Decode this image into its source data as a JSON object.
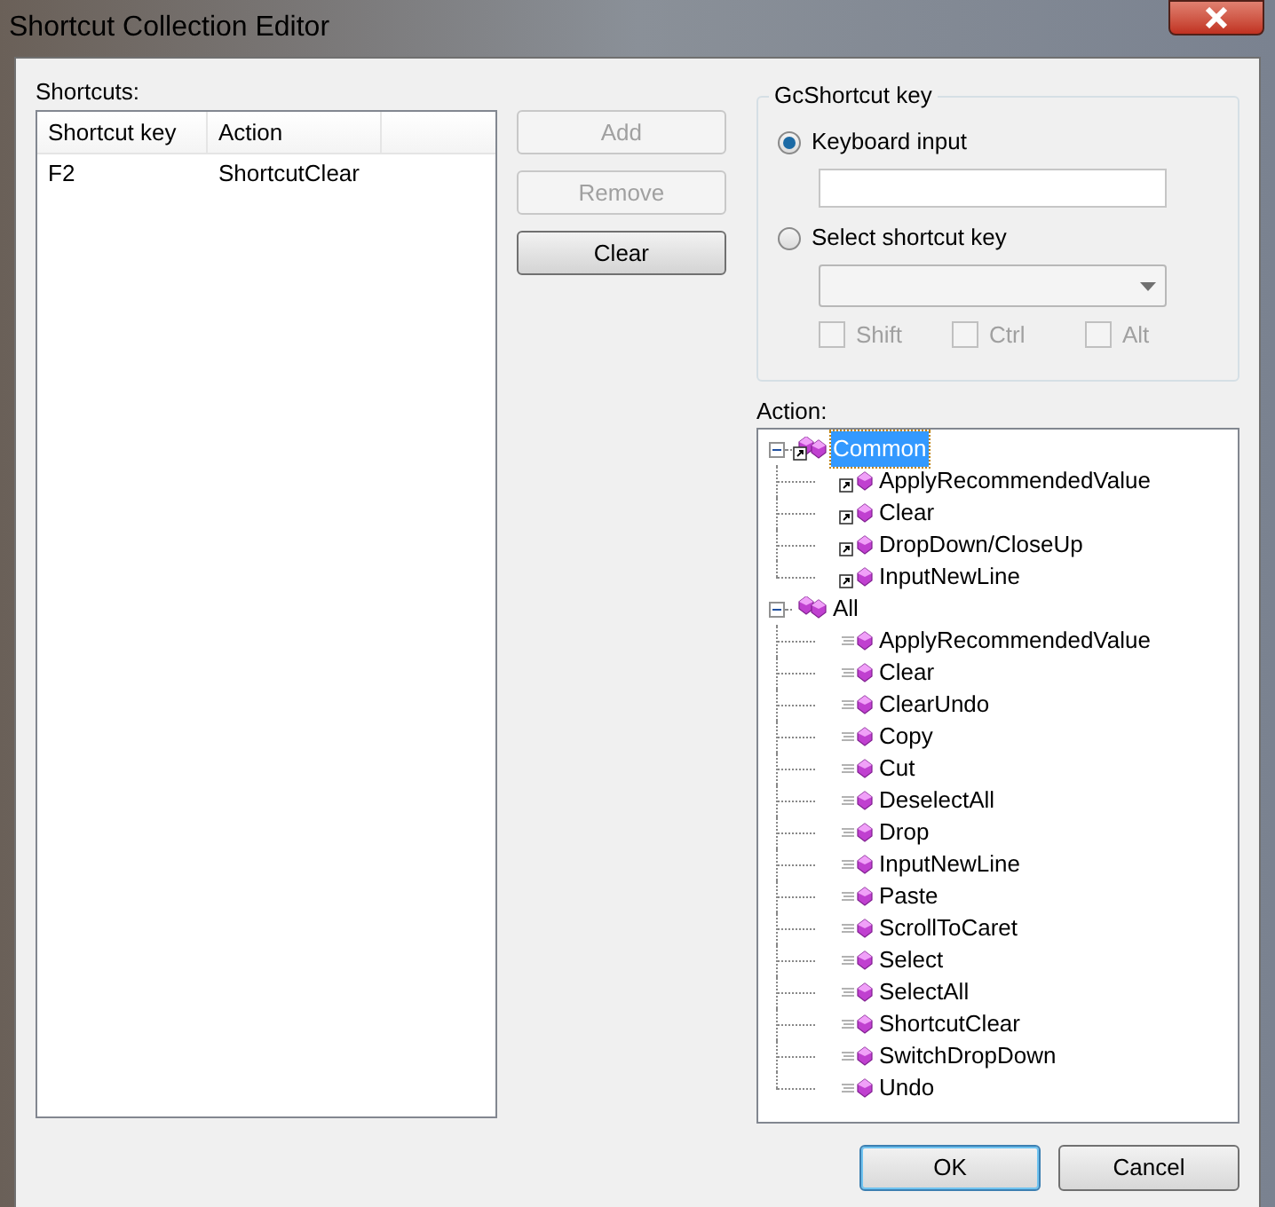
{
  "window": {
    "title": "Shortcut Collection Editor"
  },
  "shortcuts": {
    "label": "Shortcuts:",
    "columns": [
      "Shortcut key",
      "Action"
    ],
    "rows": [
      [
        "F2",
        "ShortcutClear"
      ]
    ]
  },
  "buttons": [
    {
      "label": "Add",
      "disabled": true
    },
    {
      "label": "Remove",
      "disabled": true
    },
    {
      "label": "Clear",
      "disabled": false
    }
  ],
  "group": {
    "title": "GcShortcut key",
    "options": [
      {
        "label": "Keyboard input",
        "selected": true
      },
      {
        "label": "Select shortcut key",
        "selected": false
      }
    ],
    "modifiers": [
      {
        "label": "Shift",
        "checked": false,
        "disabled": true
      },
      {
        "label": "Ctrl",
        "checked": false,
        "disabled": true
      },
      {
        "label": "Alt",
        "checked": false,
        "disabled": true
      }
    ]
  },
  "action": {
    "label": "Action:",
    "tree": [
      {
        "label": "Common",
        "kind": "shortcut",
        "expanded": true,
        "selected": true,
        "children": [
          {
            "label": "ApplyRecommendedValue",
            "kind": "shortcut",
            "selected": false
          },
          {
            "label": "Clear",
            "kind": "shortcut",
            "selected": false
          },
          {
            "label": "DropDown/CloseUp",
            "kind": "shortcut",
            "selected": false
          },
          {
            "label": "InputNewLine",
            "kind": "shortcut",
            "selected": false
          }
        ]
      },
      {
        "label": "All",
        "kind": "action",
        "expanded": true,
        "selected": false,
        "children": [
          {
            "label": "ApplyRecommendedValue",
            "kind": "action",
            "selected": false
          },
          {
            "label": "Clear",
            "kind": "action",
            "selected": false
          },
          {
            "label": "ClearUndo",
            "kind": "action",
            "selected": false
          },
          {
            "label": "Copy",
            "kind": "action",
            "selected": false
          },
          {
            "label": "Cut",
            "kind": "action",
            "selected": false
          },
          {
            "label": "DeselectAll",
            "kind": "action",
            "selected": false
          },
          {
            "label": "Drop",
            "kind": "action",
            "selected": false
          },
          {
            "label": "InputNewLine",
            "kind": "action",
            "selected": false
          },
          {
            "label": "Paste",
            "kind": "action",
            "selected": false
          },
          {
            "label": "ScrollToCaret",
            "kind": "action",
            "selected": false
          },
          {
            "label": "Select",
            "kind": "action",
            "selected": false
          },
          {
            "label": "SelectAll",
            "kind": "action",
            "selected": false
          },
          {
            "label": "ShortcutClear",
            "kind": "action",
            "selected": false
          },
          {
            "label": "SwitchDropDown",
            "kind": "action",
            "selected": false
          },
          {
            "label": "Undo",
            "kind": "action",
            "selected": false
          }
        ]
      }
    ]
  },
  "dialog_buttons": [
    {
      "label": "OK",
      "default": true
    },
    {
      "label": "Cancel",
      "default": false
    }
  ]
}
